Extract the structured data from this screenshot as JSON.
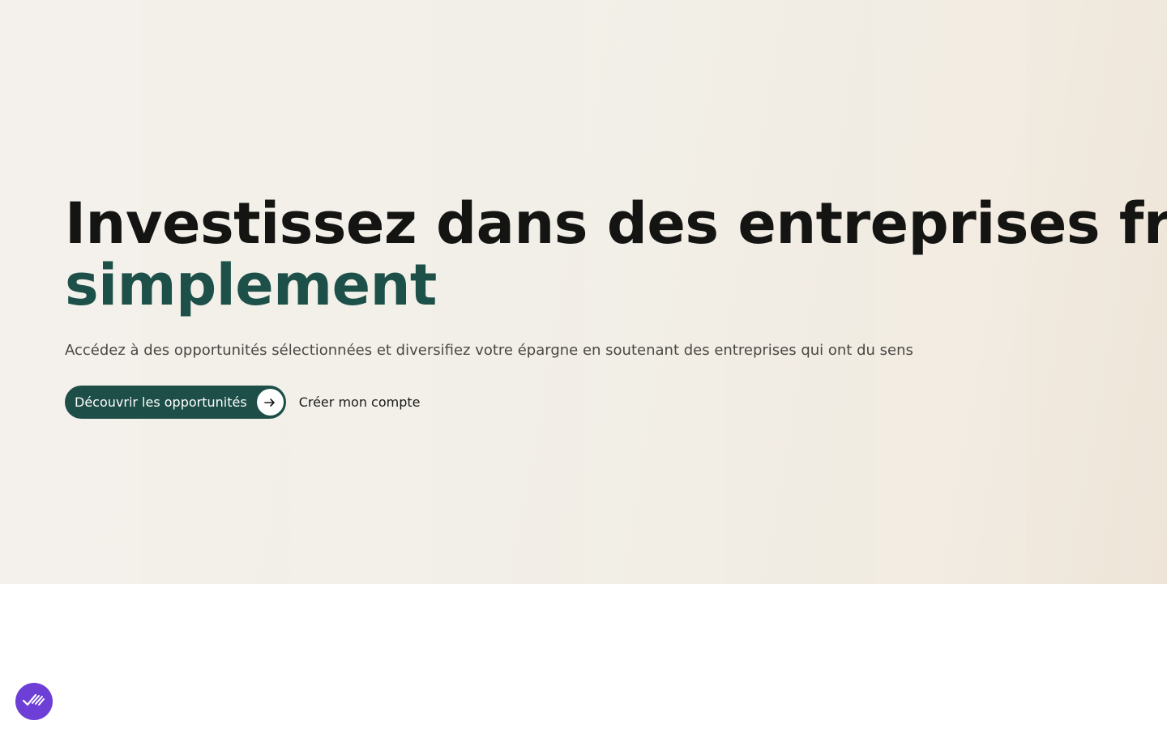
{
  "hero": {
    "headline": "Investissez dans des entreprises fra",
    "headline_accent": "simplement",
    "subtitle": "Accédez à des opportunités sélectionnées et diversifiez votre épargne en soutenant des entreprises qui ont du sens",
    "primary_cta": "Découvrir les opportunités",
    "secondary_cta": "Créer mon compte",
    "arrow_icon": "arrow-right-icon"
  },
  "floating_button": {
    "icon": "double-check-icon"
  },
  "colors": {
    "accent": "#1c5048",
    "button": "#1d4e47",
    "floating_button": "#6d3fd6",
    "hero_background": "#f2efe8"
  }
}
